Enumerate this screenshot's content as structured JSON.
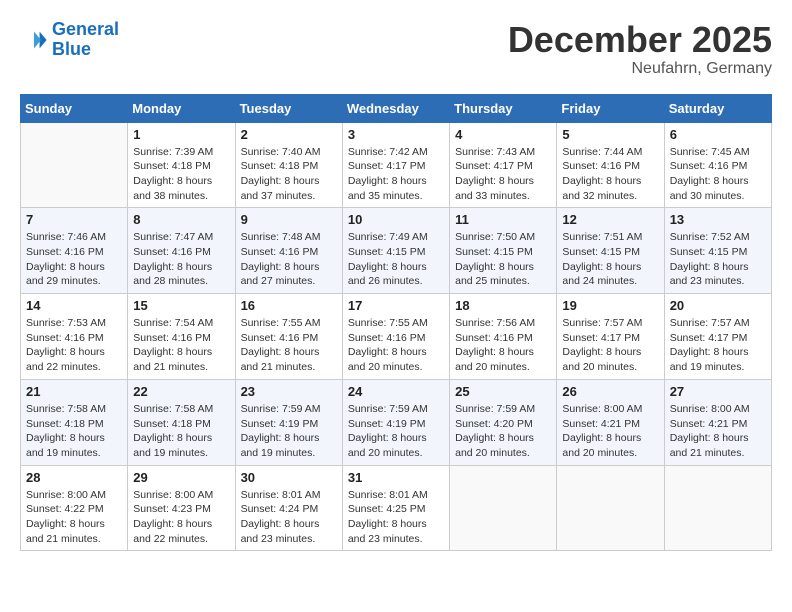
{
  "header": {
    "logo_line1": "General",
    "logo_line2": "Blue",
    "month_title": "December 2025",
    "location": "Neufahrn, Germany"
  },
  "calendar": {
    "weekdays": [
      "Sunday",
      "Monday",
      "Tuesday",
      "Wednesday",
      "Thursday",
      "Friday",
      "Saturday"
    ],
    "weeks": [
      [
        {
          "day": "",
          "info": ""
        },
        {
          "day": "1",
          "info": "Sunrise: 7:39 AM\nSunset: 4:18 PM\nDaylight: 8 hours\nand 38 minutes."
        },
        {
          "day": "2",
          "info": "Sunrise: 7:40 AM\nSunset: 4:18 PM\nDaylight: 8 hours\nand 37 minutes."
        },
        {
          "day": "3",
          "info": "Sunrise: 7:42 AM\nSunset: 4:17 PM\nDaylight: 8 hours\nand 35 minutes."
        },
        {
          "day": "4",
          "info": "Sunrise: 7:43 AM\nSunset: 4:17 PM\nDaylight: 8 hours\nand 33 minutes."
        },
        {
          "day": "5",
          "info": "Sunrise: 7:44 AM\nSunset: 4:16 PM\nDaylight: 8 hours\nand 32 minutes."
        },
        {
          "day": "6",
          "info": "Sunrise: 7:45 AM\nSunset: 4:16 PM\nDaylight: 8 hours\nand 30 minutes."
        }
      ],
      [
        {
          "day": "7",
          "info": "Sunrise: 7:46 AM\nSunset: 4:16 PM\nDaylight: 8 hours\nand 29 minutes."
        },
        {
          "day": "8",
          "info": "Sunrise: 7:47 AM\nSunset: 4:16 PM\nDaylight: 8 hours\nand 28 minutes."
        },
        {
          "day": "9",
          "info": "Sunrise: 7:48 AM\nSunset: 4:16 PM\nDaylight: 8 hours\nand 27 minutes."
        },
        {
          "day": "10",
          "info": "Sunrise: 7:49 AM\nSunset: 4:15 PM\nDaylight: 8 hours\nand 26 minutes."
        },
        {
          "day": "11",
          "info": "Sunrise: 7:50 AM\nSunset: 4:15 PM\nDaylight: 8 hours\nand 25 minutes."
        },
        {
          "day": "12",
          "info": "Sunrise: 7:51 AM\nSunset: 4:15 PM\nDaylight: 8 hours\nand 24 minutes."
        },
        {
          "day": "13",
          "info": "Sunrise: 7:52 AM\nSunset: 4:15 PM\nDaylight: 8 hours\nand 23 minutes."
        }
      ],
      [
        {
          "day": "14",
          "info": "Sunrise: 7:53 AM\nSunset: 4:16 PM\nDaylight: 8 hours\nand 22 minutes."
        },
        {
          "day": "15",
          "info": "Sunrise: 7:54 AM\nSunset: 4:16 PM\nDaylight: 8 hours\nand 21 minutes."
        },
        {
          "day": "16",
          "info": "Sunrise: 7:55 AM\nSunset: 4:16 PM\nDaylight: 8 hours\nand 21 minutes."
        },
        {
          "day": "17",
          "info": "Sunrise: 7:55 AM\nSunset: 4:16 PM\nDaylight: 8 hours\nand 20 minutes."
        },
        {
          "day": "18",
          "info": "Sunrise: 7:56 AM\nSunset: 4:16 PM\nDaylight: 8 hours\nand 20 minutes."
        },
        {
          "day": "19",
          "info": "Sunrise: 7:57 AM\nSunset: 4:17 PM\nDaylight: 8 hours\nand 20 minutes."
        },
        {
          "day": "20",
          "info": "Sunrise: 7:57 AM\nSunset: 4:17 PM\nDaylight: 8 hours\nand 19 minutes."
        }
      ],
      [
        {
          "day": "21",
          "info": "Sunrise: 7:58 AM\nSunset: 4:18 PM\nDaylight: 8 hours\nand 19 minutes."
        },
        {
          "day": "22",
          "info": "Sunrise: 7:58 AM\nSunset: 4:18 PM\nDaylight: 8 hours\nand 19 minutes."
        },
        {
          "day": "23",
          "info": "Sunrise: 7:59 AM\nSunset: 4:19 PM\nDaylight: 8 hours\nand 19 minutes."
        },
        {
          "day": "24",
          "info": "Sunrise: 7:59 AM\nSunset: 4:19 PM\nDaylight: 8 hours\nand 20 minutes."
        },
        {
          "day": "25",
          "info": "Sunrise: 7:59 AM\nSunset: 4:20 PM\nDaylight: 8 hours\nand 20 minutes."
        },
        {
          "day": "26",
          "info": "Sunrise: 8:00 AM\nSunset: 4:21 PM\nDaylight: 8 hours\nand 20 minutes."
        },
        {
          "day": "27",
          "info": "Sunrise: 8:00 AM\nSunset: 4:21 PM\nDaylight: 8 hours\nand 21 minutes."
        }
      ],
      [
        {
          "day": "28",
          "info": "Sunrise: 8:00 AM\nSunset: 4:22 PM\nDaylight: 8 hours\nand 21 minutes."
        },
        {
          "day": "29",
          "info": "Sunrise: 8:00 AM\nSunset: 4:23 PM\nDaylight: 8 hours\nand 22 minutes."
        },
        {
          "day": "30",
          "info": "Sunrise: 8:01 AM\nSunset: 4:24 PM\nDaylight: 8 hours\nand 23 minutes."
        },
        {
          "day": "31",
          "info": "Sunrise: 8:01 AM\nSunset: 4:25 PM\nDaylight: 8 hours\nand 23 minutes."
        },
        {
          "day": "",
          "info": ""
        },
        {
          "day": "",
          "info": ""
        },
        {
          "day": "",
          "info": ""
        }
      ]
    ]
  }
}
